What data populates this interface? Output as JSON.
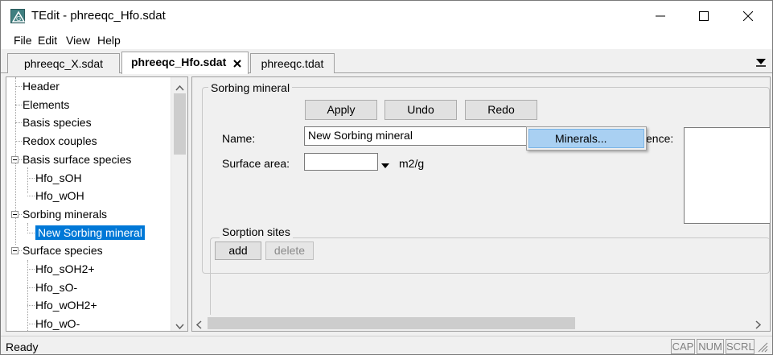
{
  "window": {
    "title": "TEdit - phreeqc_Hfo.sdat"
  },
  "menu": [
    "File",
    "Edit",
    "View",
    "Help"
  ],
  "tabs": [
    {
      "label": "phreeqc_X.sdat",
      "active": false
    },
    {
      "label": "phreeqc_Hfo.sdat",
      "active": true
    },
    {
      "label": "phreeqc.tdat",
      "active": false
    }
  ],
  "tree": {
    "items": [
      {
        "label": "Header",
        "level": 0,
        "expander": ""
      },
      {
        "label": "Elements",
        "level": 0,
        "expander": ""
      },
      {
        "label": "Basis species",
        "level": 0,
        "expander": ""
      },
      {
        "label": "Redox couples",
        "level": 0,
        "expander": ""
      },
      {
        "label": "Basis surface species",
        "level": 0,
        "expander": "minus"
      },
      {
        "label": "Hfo_sOH",
        "level": 1,
        "expander": ""
      },
      {
        "label": "Hfo_wOH",
        "level": 1,
        "expander": ""
      },
      {
        "label": "Sorbing minerals",
        "level": 0,
        "expander": "minus"
      },
      {
        "label": "New Sorbing mineral",
        "level": 1,
        "expander": "",
        "selected": true
      },
      {
        "label": "Surface species",
        "level": 0,
        "expander": "minus"
      },
      {
        "label": "Hfo_sOH2+",
        "level": 1,
        "expander": ""
      },
      {
        "label": "Hfo_sO-",
        "level": 1,
        "expander": ""
      },
      {
        "label": "Hfo_wOH2+",
        "level": 1,
        "expander": ""
      },
      {
        "label": "Hfo_wO-",
        "level": 1,
        "expander": ""
      }
    ]
  },
  "form": {
    "group_title": "Sorbing mineral",
    "apply_label": "Apply",
    "undo_label": "Undo",
    "redo_label": "Redo",
    "name_label": "Name:",
    "name_value": "New Sorbing mineral",
    "surface_area_label": "Surface area:",
    "surface_area_value": "",
    "surface_area_unit": "m2/g",
    "reference_label_partial": "ence:",
    "sorption_sites_title": "Sorption sites",
    "add_label": "add",
    "delete_label": "delete"
  },
  "dropdown": {
    "item": "Minerals..."
  },
  "status": {
    "text": "Ready",
    "indicators": [
      "CAP",
      "NUM",
      "SCRL"
    ]
  }
}
